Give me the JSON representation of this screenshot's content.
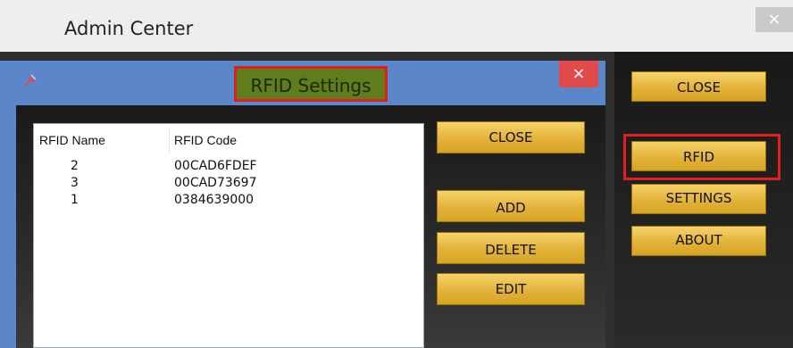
{
  "outer_window": {
    "title": "Admin Center",
    "close_glyph": "×"
  },
  "right_panel": {
    "buttons": [
      {
        "label": "CLOSE"
      },
      {
        "label": "RFID"
      },
      {
        "label": "SETTINGS"
      },
      {
        "label": "ABOUT"
      }
    ]
  },
  "dialog": {
    "title": "RFID Settings",
    "close_glyph": "×",
    "icon": "pin-icon",
    "table": {
      "columns": [
        "RFID Name",
        "RFID Code"
      ],
      "rows": [
        {
          "name": "2",
          "code": "00CAD6FDEF"
        },
        {
          "name": "3",
          "code": "00CAD73697"
        },
        {
          "name": "1",
          "code": "0384639000"
        }
      ]
    },
    "buttons": [
      {
        "label": "CLOSE"
      },
      {
        "label": "ADD"
      },
      {
        "label": "DELETE"
      },
      {
        "label": "EDIT"
      }
    ]
  },
  "colors": {
    "dialog_bg": "#5b86c9",
    "title_highlight": "#5f7d1d",
    "highlight_border": "#e0201e",
    "button_gold": "#e3b23a",
    "dialog_close": "#e24b4b"
  }
}
